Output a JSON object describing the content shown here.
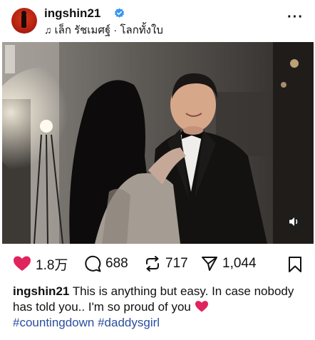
{
  "post": {
    "username": "ingshin21",
    "audio": "เล็ก รัชเมศฐ์ · โลกทั้งใบ",
    "more": "···"
  },
  "actions": {
    "likes": "1.8万",
    "comments": "688",
    "reposts": "717",
    "shares": "1,044"
  },
  "caption": {
    "username": "ingshin21",
    "text": "This is anything but easy. In case nobody has told you.. I'm so proud of you",
    "hashtags": "#countingdown #daddysgirl"
  },
  "colors": {
    "like": "#e0245e",
    "verified": "#3897f0",
    "hashtag": "#2a4ea0"
  },
  "icons": {
    "verified": "verified-badge-icon",
    "music": "music-note-icon",
    "like": "heart-filled-icon",
    "comment": "comment-bubble-icon",
    "repost": "repost-arrows-icon",
    "share": "send-paper-plane-icon",
    "save": "bookmark-icon",
    "mute": "speaker-icon"
  }
}
